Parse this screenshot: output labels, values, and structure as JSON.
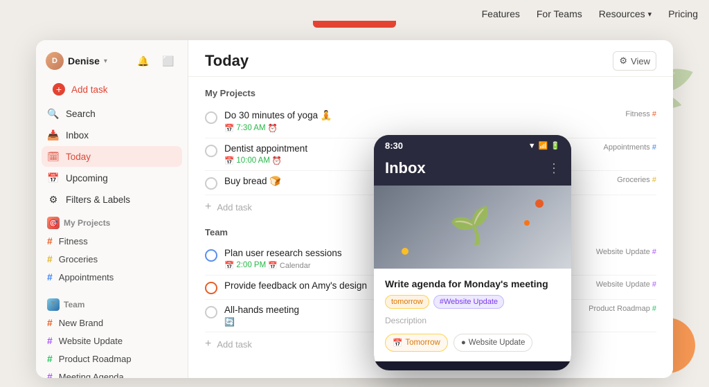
{
  "topNav": {
    "items": [
      {
        "id": "features",
        "label": "Features"
      },
      {
        "id": "for-teams",
        "label": "For Teams"
      },
      {
        "id": "resources",
        "label": "Resources",
        "hasDropdown": true
      },
      {
        "id": "pricing",
        "label": "Pricing"
      }
    ]
  },
  "sidebar": {
    "user": {
      "name": "Denise",
      "initials": "D"
    },
    "nav": [
      {
        "id": "add-task",
        "label": "Add task",
        "type": "add"
      },
      {
        "id": "search",
        "label": "Search",
        "icon": "🔍"
      },
      {
        "id": "inbox",
        "label": "Inbox",
        "icon": "📥"
      },
      {
        "id": "today",
        "label": "Today",
        "icon": "🗓",
        "active": true
      },
      {
        "id": "upcoming",
        "label": "Upcoming",
        "icon": "📅"
      },
      {
        "id": "filters",
        "label": "Filters & Labels",
        "icon": "⚙"
      }
    ],
    "myProjects": {
      "title": "My Projects",
      "items": [
        {
          "id": "fitness",
          "label": "Fitness",
          "color": "orange"
        },
        {
          "id": "groceries",
          "label": "Groceries",
          "color": "yellow"
        },
        {
          "id": "appointments",
          "label": "Appointments",
          "color": "blue"
        }
      ]
    },
    "team": {
      "title": "Team",
      "items": [
        {
          "id": "new-brand",
          "label": "New Brand",
          "color": "orange"
        },
        {
          "id": "website-update",
          "label": "Website Update",
          "color": "purple"
        },
        {
          "id": "product-roadmap",
          "label": "Product Roadmap",
          "color": "green"
        },
        {
          "id": "meeting-agenda",
          "label": "Meeting Agenda",
          "color": "blue"
        }
      ]
    }
  },
  "main": {
    "title": "Today",
    "viewLabel": "View",
    "sections": {
      "myProjects": {
        "title": "My Projects",
        "tasks": [
          {
            "id": "yoga",
            "name": "Do 30 minutes of yoga 🧘",
            "time": "7:30 AM",
            "hasAlarm": true,
            "tag": "Fitness",
            "tagColor": "orange"
          },
          {
            "id": "dentist",
            "name": "Dentist appointment",
            "time": "10:00 AM",
            "hasAlarm": true,
            "tag": "Appointments",
            "tagColor": "blue"
          },
          {
            "id": "bread",
            "name": "Buy bread 🍞",
            "tag": "Groceries",
            "tagColor": "yellow"
          }
        ],
        "addLabel": "Add task"
      },
      "team": {
        "title": "Team",
        "tasks": [
          {
            "id": "research",
            "name": "Plan user research sessions",
            "time": "2:00 PM",
            "timeIcon": "calendar",
            "tag": "Website Update",
            "tagColor": "purple",
            "priority": "blue"
          },
          {
            "id": "feedback",
            "name": "Provide feedback on Amy's design",
            "priority": "orange",
            "tag": "Website Update",
            "tagColor": "purple"
          },
          {
            "id": "allhands",
            "name": "All-hands meeting",
            "tag": "Product Roadmap",
            "tagColor": "green"
          }
        ],
        "addLabel": "Add task"
      }
    }
  },
  "mobile": {
    "time": "8:30",
    "title": "Inbox",
    "card": {
      "title": "Write agenda for Monday's meeting",
      "tags": [
        {
          "label": "tomorrow",
          "type": "tomorrow"
        },
        {
          "label": "#Website Update",
          "type": "website"
        }
      ],
      "descriptionLabel": "Description",
      "actions": [
        {
          "label": "Tomorrow",
          "icon": "📅",
          "type": "tomorrow"
        },
        {
          "label": "Website Update",
          "icon": "●",
          "type": "website"
        }
      ]
    }
  }
}
